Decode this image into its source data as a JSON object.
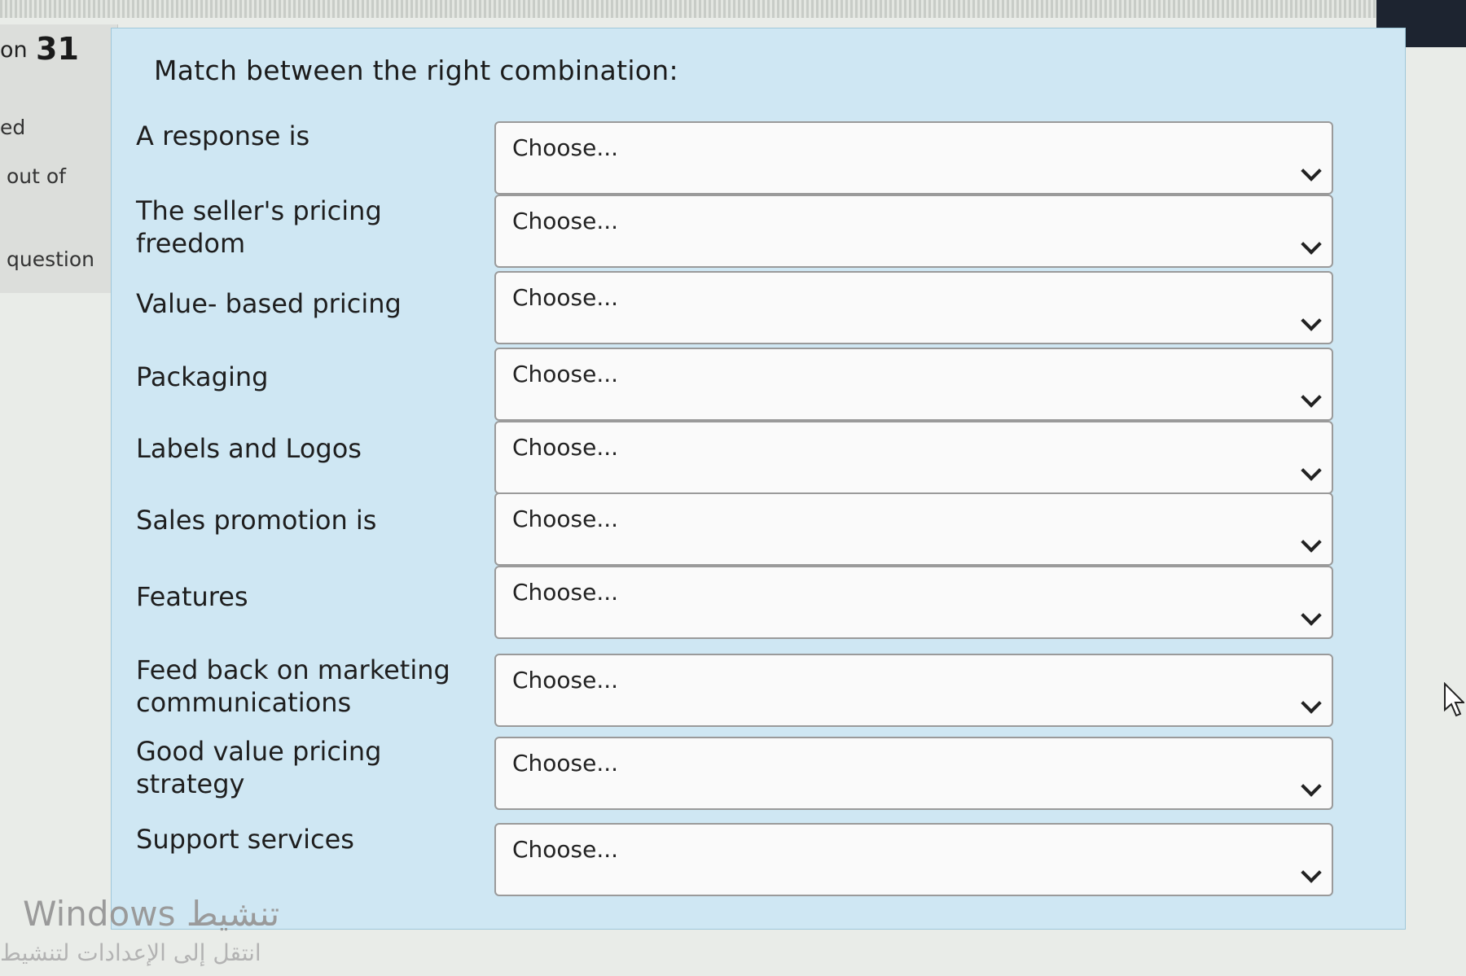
{
  "question_info": {
    "prefix": "on",
    "number": "31",
    "status": "ed",
    "mark": "out of",
    "flag": "question"
  },
  "question": {
    "prompt": "Match between the right combination:",
    "rows": [
      {
        "label": "A response is",
        "selected": "Choose..."
      },
      {
        "label": "The seller's pricing freedom",
        "selected": "Choose..."
      },
      {
        "label": "Value- based pricing",
        "selected": "Choose..."
      },
      {
        "label": "Packaging",
        "selected": "Choose..."
      },
      {
        "label": "Labels and Logos",
        "selected": "Choose..."
      },
      {
        "label": "Sales promotion is",
        "selected": "Choose..."
      },
      {
        "label": "Features",
        "selected": "Choose..."
      },
      {
        "label": "Feed back on marketing communications",
        "selected": "Choose..."
      },
      {
        "label": "Good value pricing strategy",
        "selected": "Choose..."
      },
      {
        "label": "Support services",
        "selected": "Choose..."
      }
    ]
  },
  "watermark": {
    "line1": "Windows تنشيط",
    "line2": "انتقل إلى الإعدادات لتنشيط"
  }
}
